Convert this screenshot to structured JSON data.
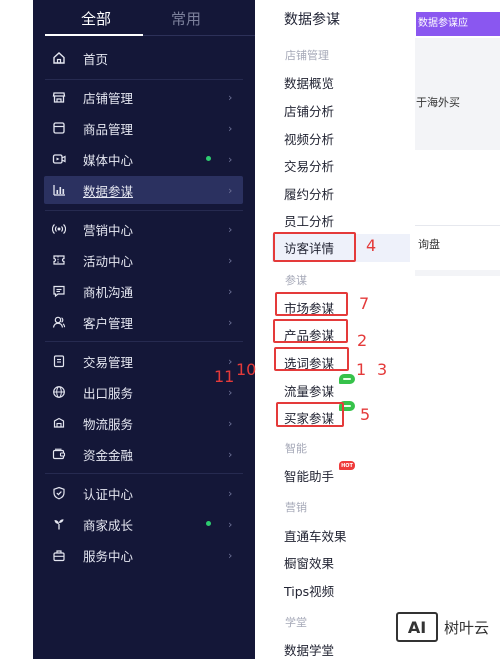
{
  "sidebar": {
    "tabs": {
      "all": "全部",
      "common": "常用"
    },
    "items": [
      {
        "label": "首页",
        "icon": "home-icon"
      },
      {
        "label": "店铺管理",
        "icon": "store-icon"
      },
      {
        "label": "商品管理",
        "icon": "product-icon"
      },
      {
        "label": "媒体中心",
        "icon": "media-icon",
        "dot": true
      },
      {
        "label": "数据参谋",
        "icon": "chart-icon",
        "active": true
      },
      {
        "label": "营销中心",
        "icon": "broadcast-icon"
      },
      {
        "label": "活动中心",
        "icon": "ticket-icon"
      },
      {
        "label": "商机沟通",
        "icon": "chat-icon"
      },
      {
        "label": "客户管理",
        "icon": "customer-icon"
      },
      {
        "label": "交易管理",
        "icon": "order-icon"
      },
      {
        "label": "出口服务",
        "icon": "globe-icon"
      },
      {
        "label": "物流服务",
        "icon": "truck-icon"
      },
      {
        "label": "资金金融",
        "icon": "wallet-icon"
      },
      {
        "label": "认证中心",
        "icon": "shield-icon"
      },
      {
        "label": "商家成长",
        "icon": "sprout-icon",
        "dot": true
      },
      {
        "label": "服务中心",
        "icon": "service-icon"
      }
    ],
    "dot_color": "#2dcc70"
  },
  "submenu": {
    "title": "数据参谋",
    "sections": {
      "store": "店铺管理",
      "canmou": "参谋",
      "smart": "智能",
      "marketing": "营销",
      "academy": "学堂"
    },
    "items": {
      "overview": "数据概览",
      "store_analysis": "店铺分析",
      "video_analysis": "视频分析",
      "trade_analysis": "交易分析",
      "fulfill_analysis": "履约分析",
      "staff_analysis": "员工分析",
      "visitor_detail": "访客详情",
      "market": "市场参谋",
      "product": "产品参谋",
      "keyword": "选词参谋",
      "traffic": "流量参谋",
      "buyer": "买家参谋",
      "assistant": "智能助手",
      "p4p": "直通车效果",
      "showcase": "橱窗效果",
      "tips_video": "Tips视频",
      "academy": "数据学堂"
    },
    "hot_badge": "HOT"
  },
  "annotations": {
    "n4": "4",
    "n7": "7",
    "n2": "2",
    "n1": "1",
    "n3": "3",
    "n5": "5",
    "n11": "11",
    "n10": "10",
    "color": "#e43a3a"
  },
  "background": {
    "purple_tab": "数据参谋应",
    "text1": "于海外买",
    "text2": "询盘"
  },
  "watermark": {
    "logo": "AI",
    "text": "树叶云"
  }
}
